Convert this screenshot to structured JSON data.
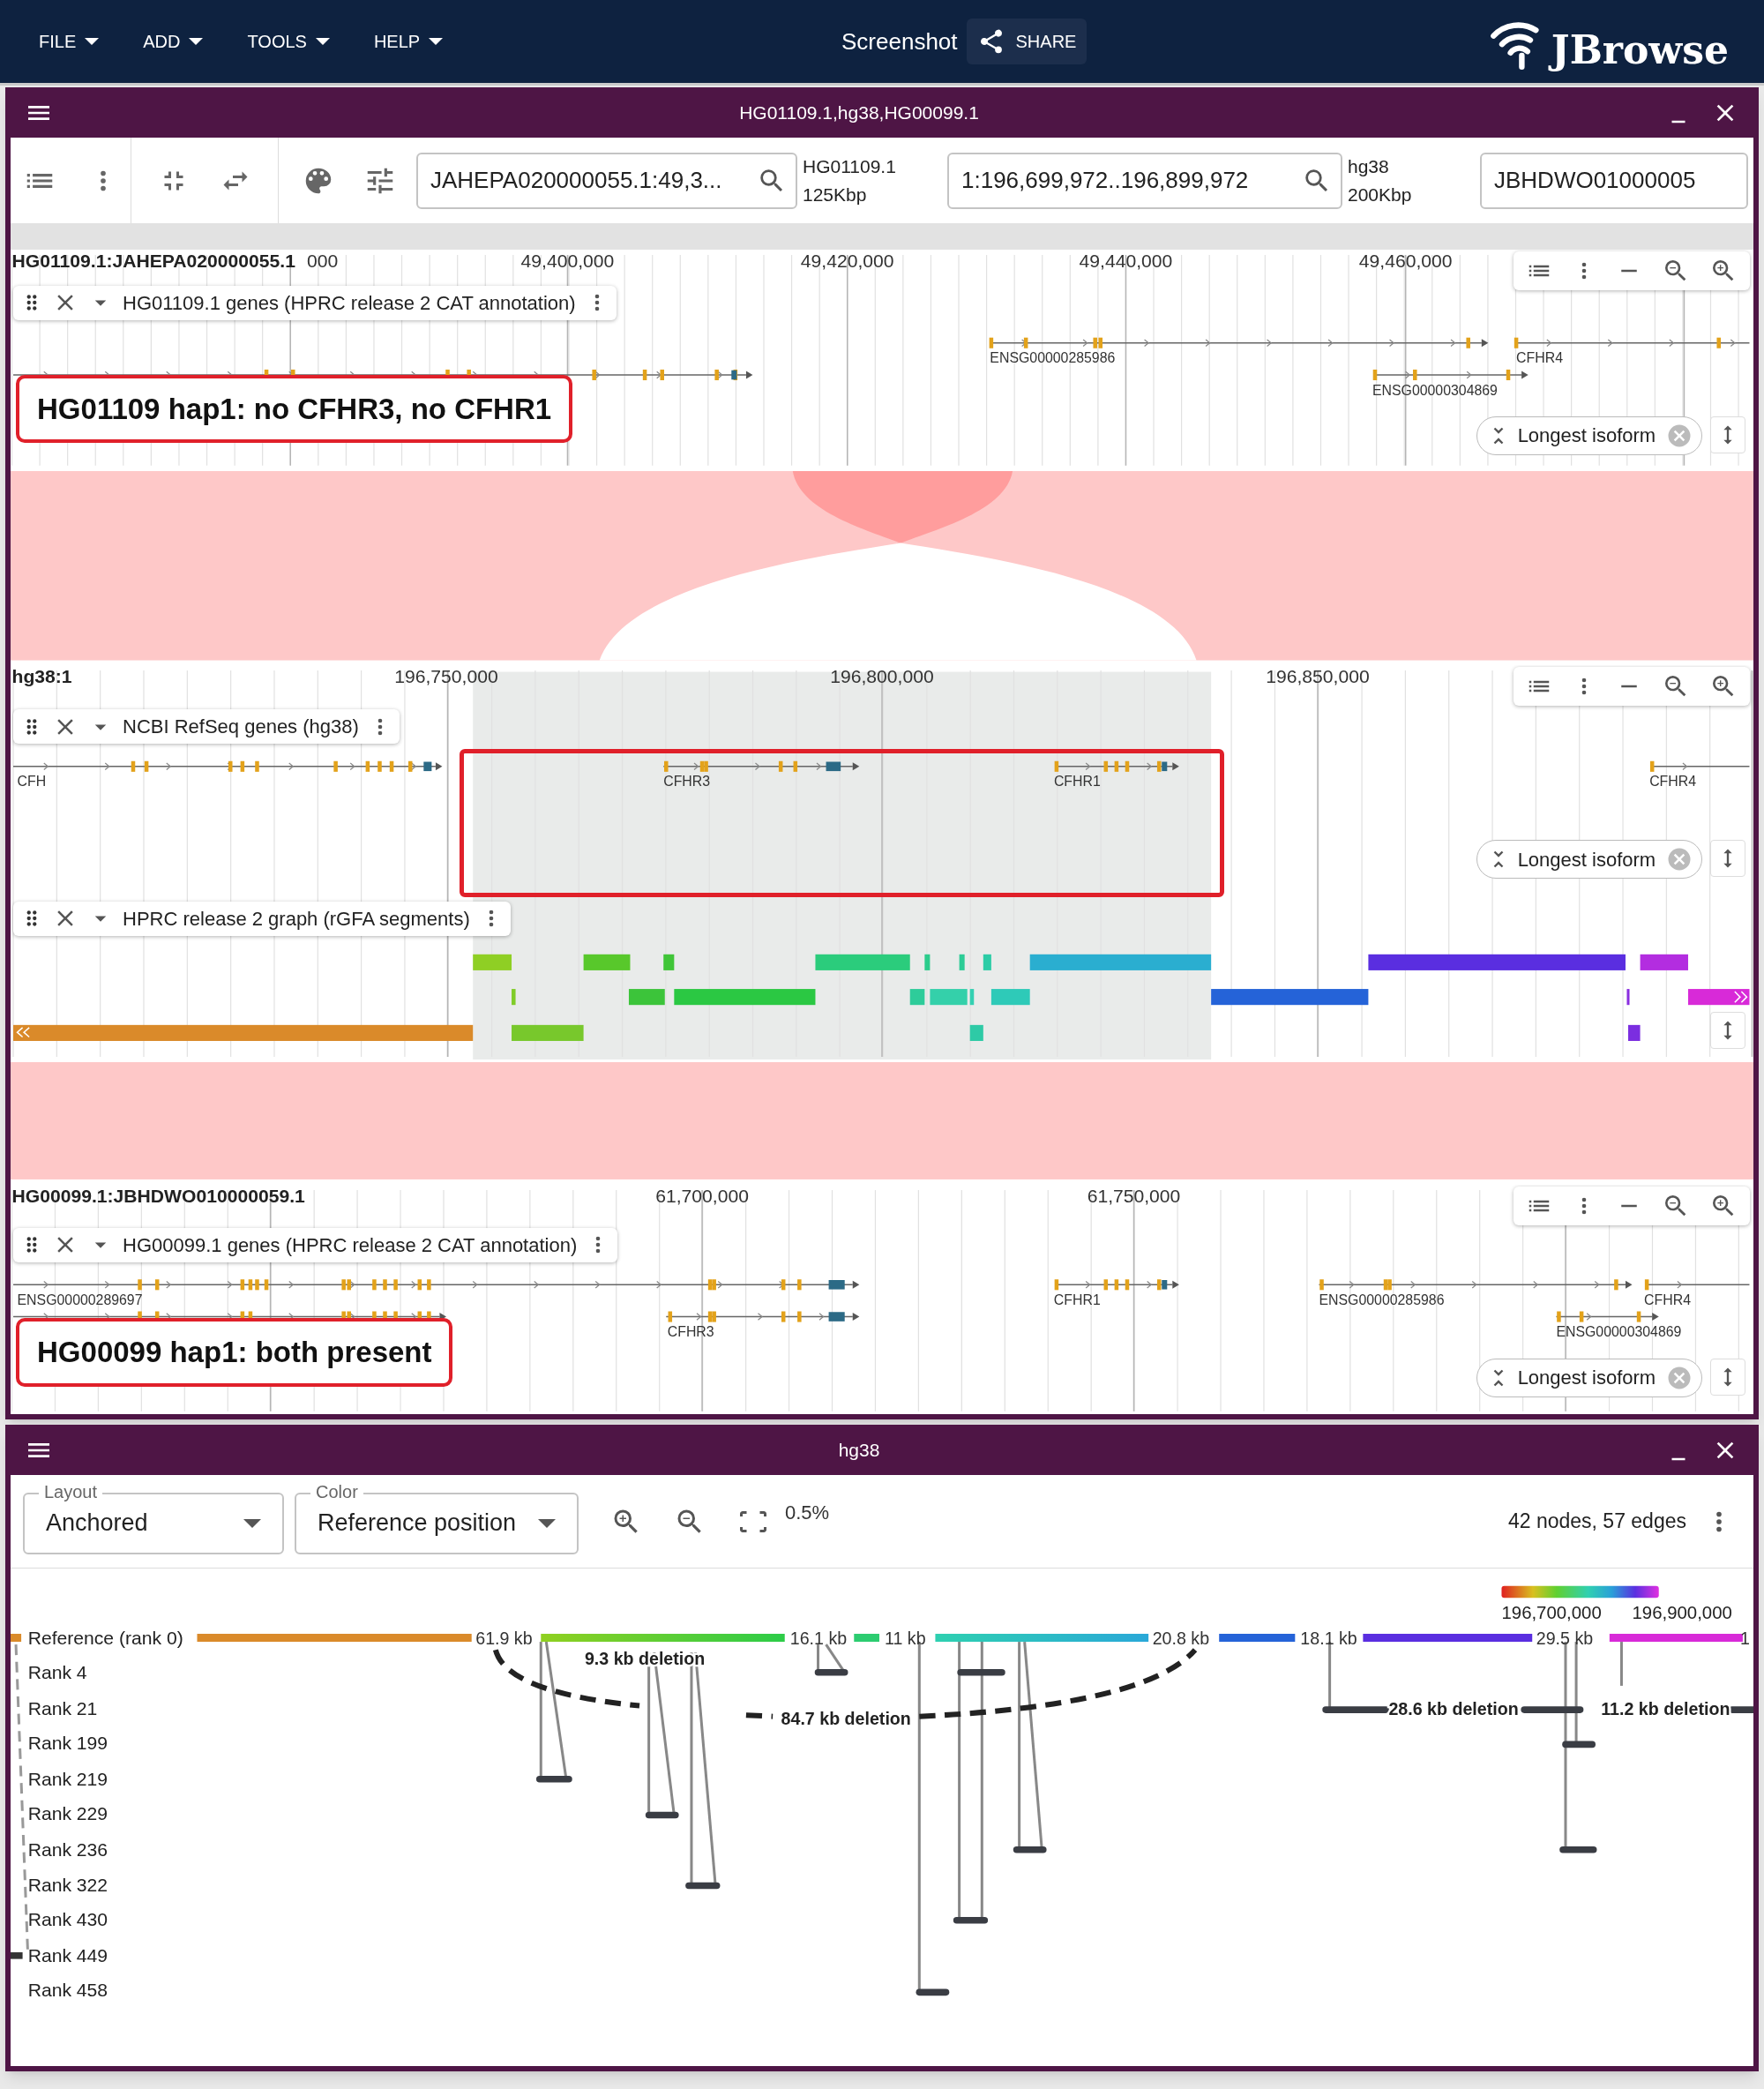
{
  "menu": [
    {
      "label": "FILE"
    },
    {
      "label": "ADD"
    },
    {
      "label": "TOOLS"
    },
    {
      "label": "HELP"
    }
  ],
  "header": {
    "title": "Screenshot",
    "share_button": "SHARE",
    "logo": "JBrowse"
  },
  "synteny_window": {
    "title": "HG01109.1,hg38,HG00099.1",
    "locations": [
      {
        "value": "JAHEPA020000055.1:49,3...",
        "assembly": "HG01109.1",
        "span": "125Kbp"
      },
      {
        "value": "1:196,699,972..196,899,972",
        "assembly": "hg38",
        "span": "200Kbp"
      },
      {
        "value": "JBHDWO01000005"
      }
    ],
    "views": [
      {
        "region": "HG01109.1:JAHEPA020000055.1",
        "ticks": [
          "000",
          "49,400,000",
          "49,420,000",
          "49,440,000",
          "49,460,000"
        ],
        "tracks": [
          {
            "name": "HG01109.1 genes (HPRC release 2 CAT annotation)",
            "genes": [
              "ENSG00000285986",
              "CFHR4",
              "ENSG00000304869"
            ],
            "filter": "Longest isoform"
          }
        ],
        "note": "HG01109 hap1: no CFHR3, no CFHR1"
      },
      {
        "region": "hg38:1",
        "ticks": [
          "196,750,000",
          "196,800,000",
          "196,850,000"
        ],
        "tracks": [
          {
            "name": "NCBI RefSeq genes (hg38)",
            "genes": [
              "CFH",
              "CFHR3",
              "CFHR1",
              "CFHR4"
            ],
            "filter": "Longest isoform"
          },
          {
            "name": "HPRC release 2 graph (rGFA segments)"
          }
        ]
      },
      {
        "region": "HG00099.1:JBHDWO010000059.1",
        "ticks": [
          "61,700,000",
          "61,750,000"
        ],
        "tracks": [
          {
            "name": "HG00099.1 genes (HPRC release 2 CAT annotation)",
            "genes": [
              "ENSG00000289697",
              "CFHR1",
              "ENSG00000285986",
              "CFHR4",
              "CFHR3",
              "ENSG00000304869"
            ],
            "filter": "Longest isoform"
          }
        ],
        "note": "HG00099 hap1: both present"
      }
    ]
  },
  "graph_window": {
    "title": "hg38",
    "layout": {
      "label": "Layout",
      "value": "Anchored"
    },
    "color": {
      "label": "Color",
      "value": "Reference position"
    },
    "zoom": "0.5%",
    "stats": "42 nodes, 57 edges",
    "legend": [
      "196,700,000",
      "196,900,000"
    ],
    "paths": [
      "Reference (rank 0)",
      "Rank 4",
      "Rank 21",
      "Rank 199",
      "Rank 219",
      "Rank 229",
      "Rank 236",
      "Rank 322",
      "Rank 430",
      "Rank 449",
      "Rank 458"
    ],
    "segment_lengths": [
      "61.9 kb",
      "16.1 kb",
      "11 kb",
      "20.8 kb",
      "18.1 kb",
      "29.5 kb",
      "1"
    ],
    "deletions": [
      "9.3 kb deletion",
      "84.7 kb deletion",
      "28.6 kb deletion",
      "11.2 kb deletion"
    ]
  }
}
